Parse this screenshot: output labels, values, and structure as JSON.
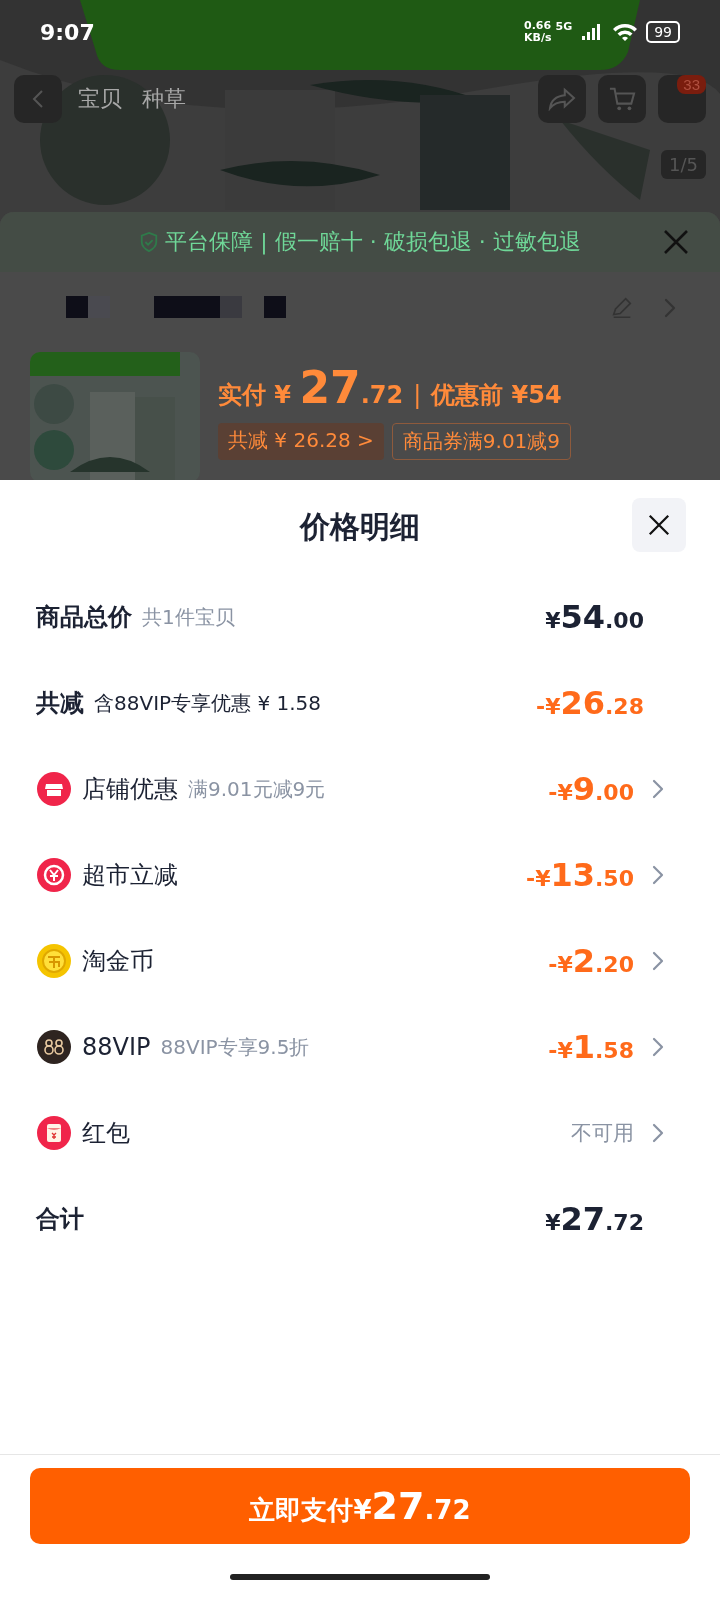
{
  "status_bar": {
    "time": "9:07",
    "net_speed": "0.66",
    "net_unit": "KB/s",
    "network": "5G",
    "battery": "99"
  },
  "nav": {
    "tabs": [
      {
        "label": "宝贝",
        "selected": false
      },
      {
        "label": "种草",
        "selected": false
      }
    ],
    "cart_badge": "33",
    "page_counter": "1/5"
  },
  "order_sheet": {
    "guarantee": "平台保障 | 假一赔十 · 破损包退 · 过敏包退",
    "price_label": "实付",
    "price_currency": "¥",
    "price_integer": "27",
    "price_decimal": ".72",
    "separator": "|",
    "original_price": "优惠前 ¥54",
    "tags": [
      {
        "text": "共减 ¥ 26.28 >",
        "kind": "filled"
      },
      {
        "text": "商品券满9.01减9",
        "kind": "outline"
      }
    ]
  },
  "price_detail": {
    "title": "价格明细",
    "rows": [
      {
        "kind": "summary",
        "label": "商品总价",
        "note": "共1件宝贝",
        "discount": false,
        "amount": {
          "currency": "¥",
          "integer": "54",
          "decimal": ".00"
        },
        "link": false
      },
      {
        "kind": "summary",
        "label": "共减",
        "note": "含88VIP专享优惠 ¥ 1.58",
        "discount": true,
        "amount": {
          "currency": "-¥",
          "integer": "26",
          "decimal": ".28"
        },
        "link": false
      },
      {
        "kind": "shop",
        "label": "店铺优惠",
        "note": "满9.01元减9元",
        "discount": true,
        "amount": {
          "currency": "-¥",
          "integer": "9",
          "decimal": ".00"
        },
        "link": true
      },
      {
        "kind": "yen",
        "label": "超市立减",
        "discount": true,
        "amount": {
          "currency": "-¥",
          "integer": "13",
          "decimal": ".50"
        },
        "link": true
      },
      {
        "kind": "coin",
        "label": "淘金币",
        "discount": true,
        "amount": {
          "currency": "-¥",
          "integer": "2",
          "decimal": ".20"
        },
        "link": true
      },
      {
        "kind": "vip",
        "label": "88VIP",
        "note": "88VIP专享9.5折",
        "discount": true,
        "amount": {
          "currency": "-¥",
          "integer": "1",
          "decimal": ".58"
        },
        "link": true
      },
      {
        "kind": "envelope",
        "label": "红包",
        "status": "不可用",
        "link": true
      },
      {
        "kind": "summary",
        "label": "合计",
        "discount": false,
        "amount": {
          "currency": "¥",
          "integer": "27",
          "decimal": ".72"
        },
        "link": false
      }
    ],
    "pay_button": {
      "label": "立即支付",
      "currency": "¥",
      "integer": "27",
      "decimal": ".72"
    }
  }
}
